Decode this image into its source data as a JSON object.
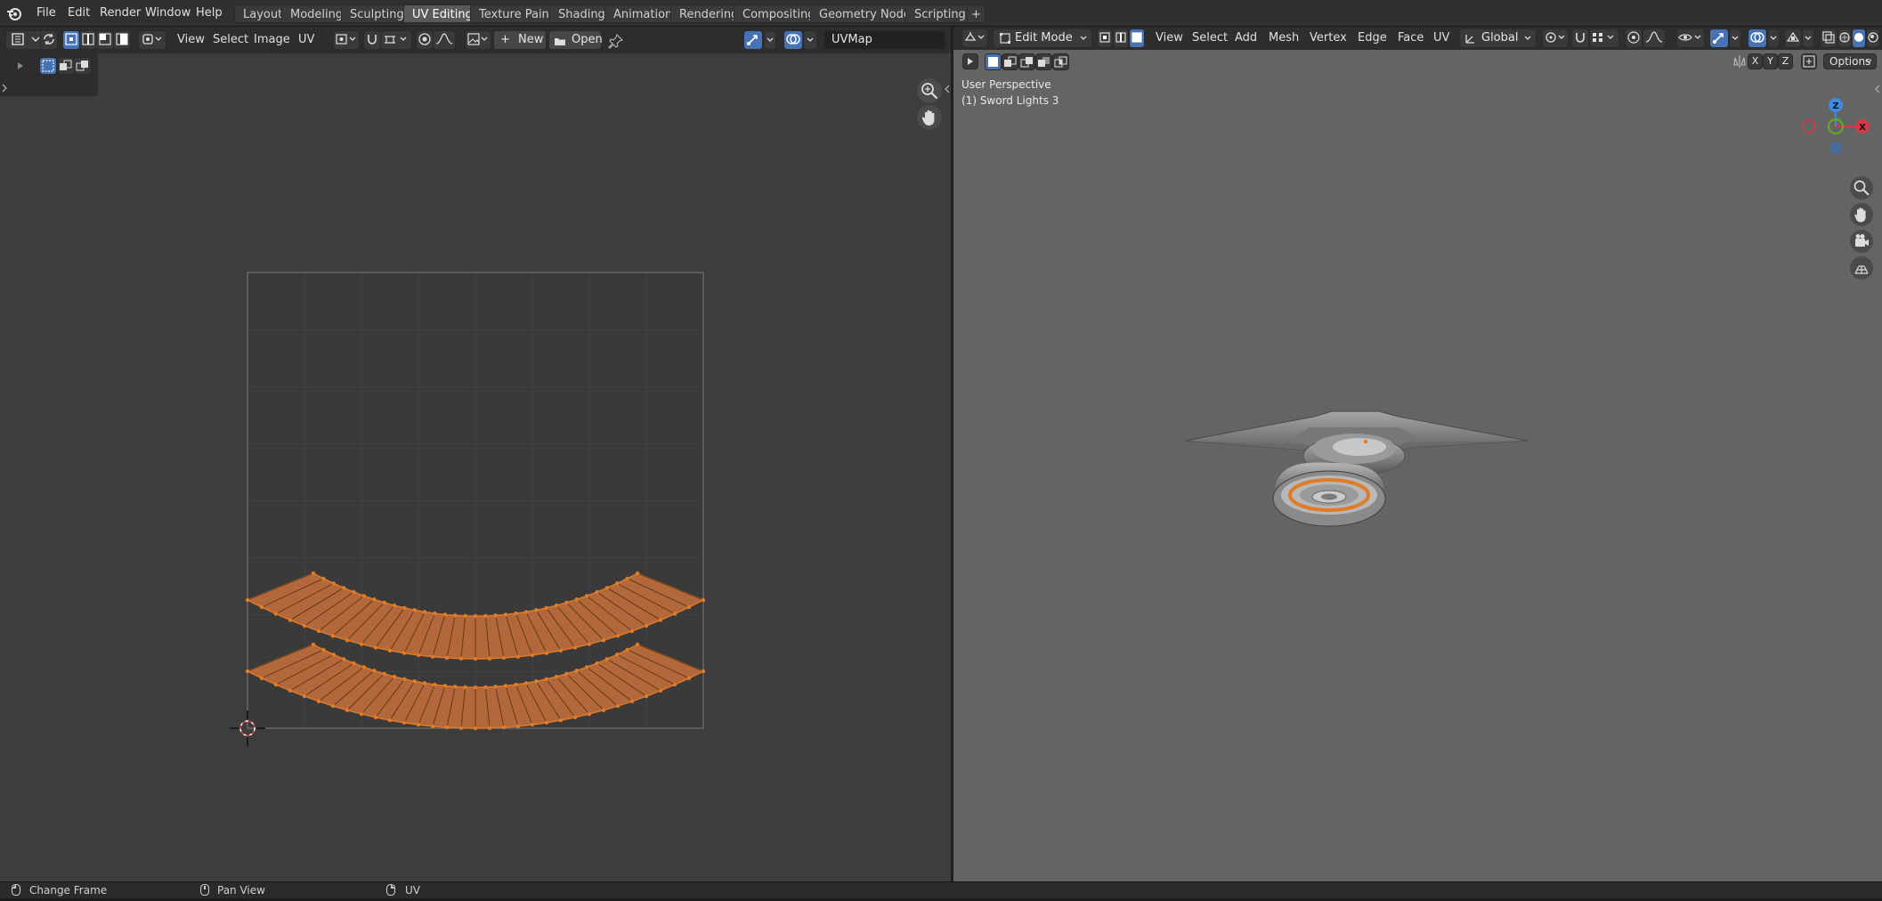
{
  "app": {
    "menus": [
      "File",
      "Edit",
      "Render",
      "Window",
      "Help"
    ],
    "workspace_tabs": [
      "Layout",
      "Modeling",
      "Sculpting",
      "UV Editing",
      "Texture Paint",
      "Shading",
      "Animation",
      "Rendering",
      "Compositing",
      "Geometry Nodes",
      "Scripting"
    ],
    "active_tab": "UV Editing",
    "add_tab_label": "+"
  },
  "uv_editor": {
    "menus": [
      "View",
      "Select",
      "Image",
      "UV"
    ],
    "new_label": "New",
    "open_label": "Open",
    "uvmap_value": "UVMap"
  },
  "viewport": {
    "mode_label": "Edit Mode",
    "menus": [
      "View",
      "Select",
      "Add",
      "Mesh",
      "Vertex",
      "Edge",
      "Face",
      "UV"
    ],
    "transform_orientation": "Global",
    "axis_toggles": [
      "X",
      "Y",
      "Z"
    ],
    "options_label": "Options",
    "perspective_label": "User Perspective",
    "object_label": "(1) Sword Lights 3",
    "gizmo_axes": {
      "z": "Z",
      "x": "X"
    }
  },
  "statusbar": {
    "items": [
      "Change Frame",
      "Pan View",
      "UV"
    ]
  },
  "colors": {
    "accent": "#4772b3",
    "selection_orange": "#e07b28",
    "axis_x": "#d63844",
    "axis_y": "#6aa52a",
    "axis_z": "#3f8ae0"
  }
}
